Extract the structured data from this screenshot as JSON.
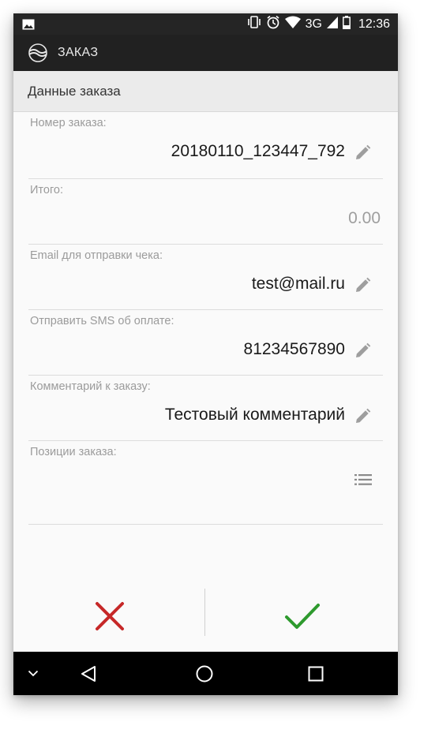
{
  "status_bar": {
    "network": "3G",
    "time": "12:36",
    "icons": [
      "image-notification-icon",
      "vibrate-icon",
      "alarm-icon",
      "wifi-icon",
      "signal-icon",
      "battery-icon"
    ]
  },
  "app_bar": {
    "title": "ЗАКАЗ",
    "logo_icon": "app-logo-icon"
  },
  "section": {
    "title": "Данные заказа"
  },
  "fields": [
    {
      "label": "Номер заказа:",
      "value": "20180110_123447_792",
      "editable": true
    },
    {
      "label": "Итого:",
      "value": "0.00",
      "editable": false
    },
    {
      "label": "Email для отправки чека:",
      "value": "test@mail.ru",
      "editable": true
    },
    {
      "label": "Отправить SMS об оплате:",
      "value": "81234567890",
      "editable": true
    },
    {
      "label": "Комментарий к заказу:",
      "value": "Тестовый комментарий",
      "editable": true
    },
    {
      "label": "Позиции заказа:",
      "value": "",
      "editable": false
    }
  ],
  "actions": {
    "cancel_icon": "close-icon",
    "confirm_icon": "check-icon",
    "cancel_color": "#c62828",
    "confirm_color": "#2e9a2e"
  },
  "nav": {
    "icons": [
      "chevron-down-icon",
      "back-icon",
      "home-icon",
      "recents-icon"
    ]
  }
}
